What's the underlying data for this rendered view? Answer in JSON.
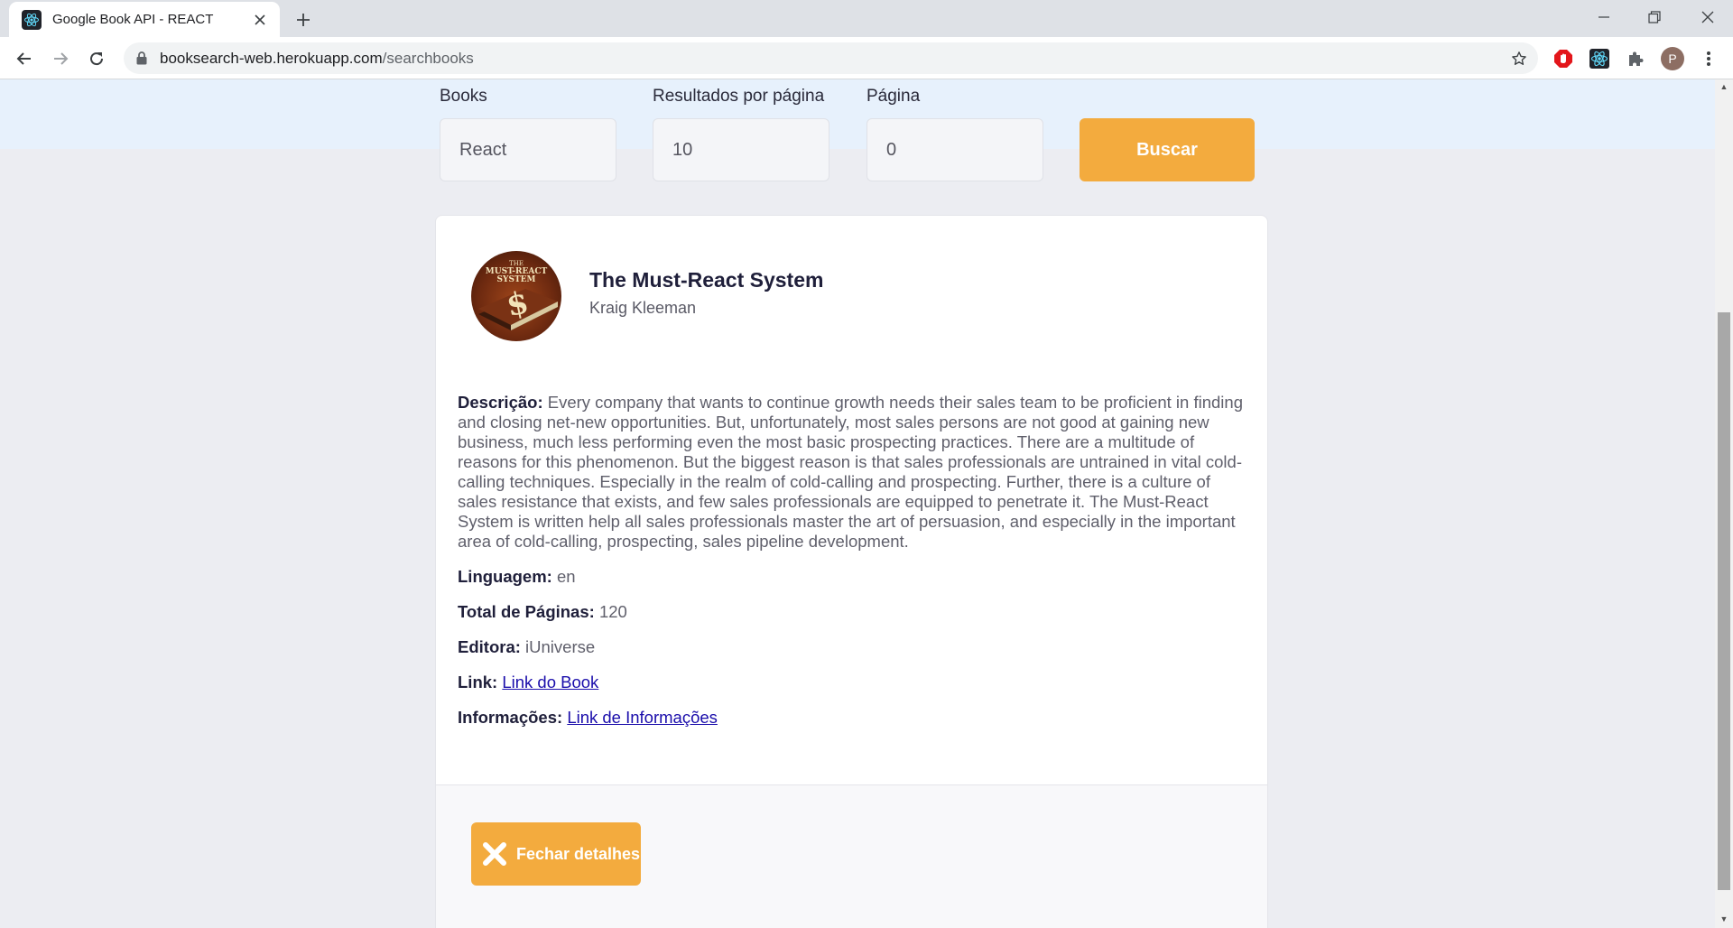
{
  "browser": {
    "tab_title": "Google Book API - REACT",
    "url_host": "booksearch-web.herokuapp.com",
    "url_path": "/searchbooks",
    "profile_initial": "P"
  },
  "search": {
    "books_label": "Books",
    "books_value": "React",
    "results_label": "Resultados por página",
    "results_value": "10",
    "page_label": "Página",
    "page_value": "0",
    "submit_label": "Buscar"
  },
  "book": {
    "title": "The Must-React System",
    "author": "Kraig Kleeman",
    "description_label": "Descrição:",
    "description": "Every company that wants to continue growth needs their sales team to be proficient in finding and closing net-new opportunities. But, unfortunately, most sales persons are not good at gaining new business, much less performing even the most basic prospecting practices. There are a multitude of reasons for this phenomenon. But the biggest reason is that sales professionals are untrained in vital cold-calling techniques. Especially in the realm of cold-calling and prospecting. Further, there is a culture of sales resistance that exists, and few sales professionals are equipped to penetrate it. The Must-React System is written help all sales professionals master the art of persuasion, and especially in the important area of cold-calling, prospecting, sales pipeline development.",
    "language_label": "Linguagem:",
    "language": "en",
    "pages_label": "Total de Páginas:",
    "pages": "120",
    "publisher_label": "Editora:",
    "publisher": "iUniverse",
    "link_label": "Link:",
    "link_text": "Link do Book",
    "info_label": "Informações:",
    "info_text": "Link de Informações",
    "close_label": "Fechar detalhes"
  },
  "colors": {
    "accent": "#f3ab3e",
    "search_band": "#e7f1fc",
    "page_bg": "#ecedf2"
  }
}
